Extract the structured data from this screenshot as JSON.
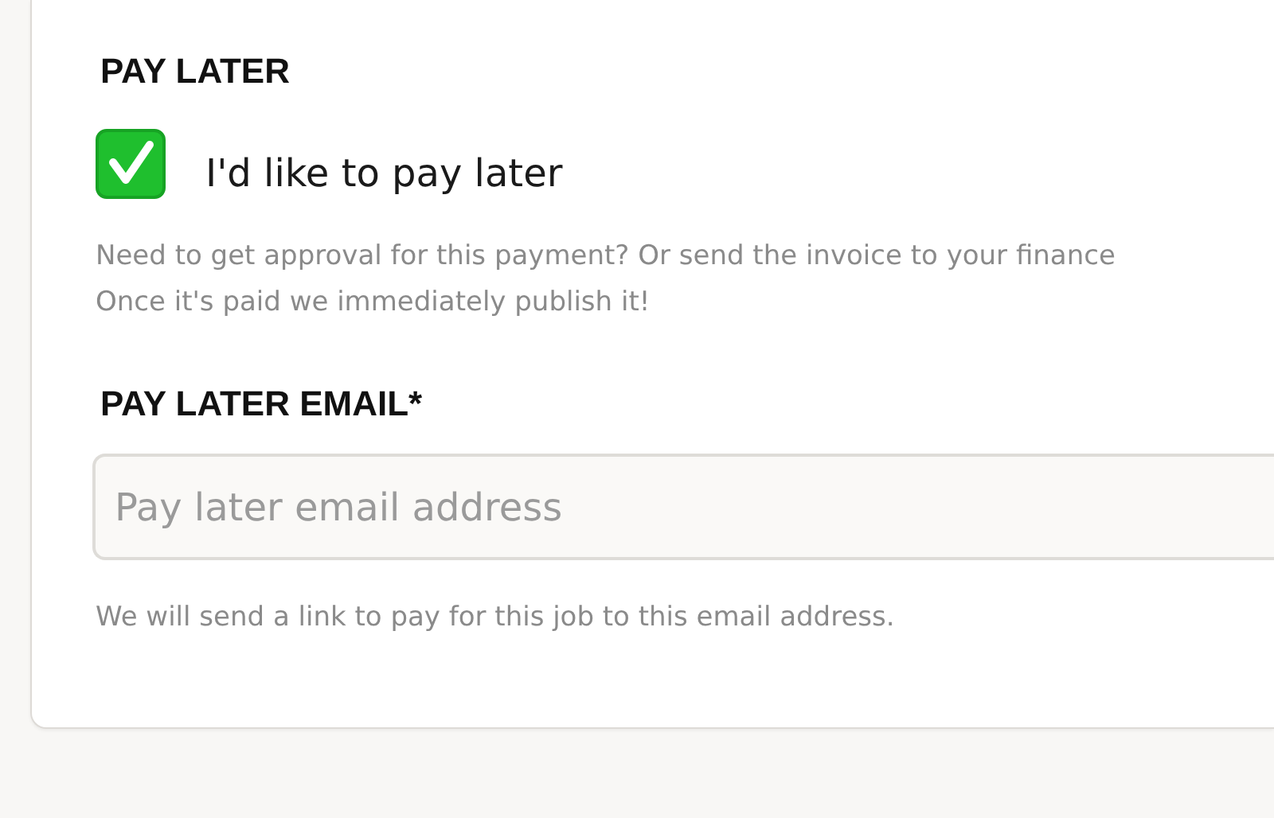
{
  "pay_later": {
    "heading": "PAY LATER",
    "checkbox": {
      "label": "I'd like to pay later",
      "checked": true
    },
    "description": "Need to get approval for this payment? Or send the invoice to your finance\nOnce it's paid we immediately publish it!"
  },
  "pay_later_email": {
    "label": "PAY LATER EMAIL*",
    "placeholder": "Pay later email address",
    "hint": "We will send a link to pay for this job to this email address."
  }
}
